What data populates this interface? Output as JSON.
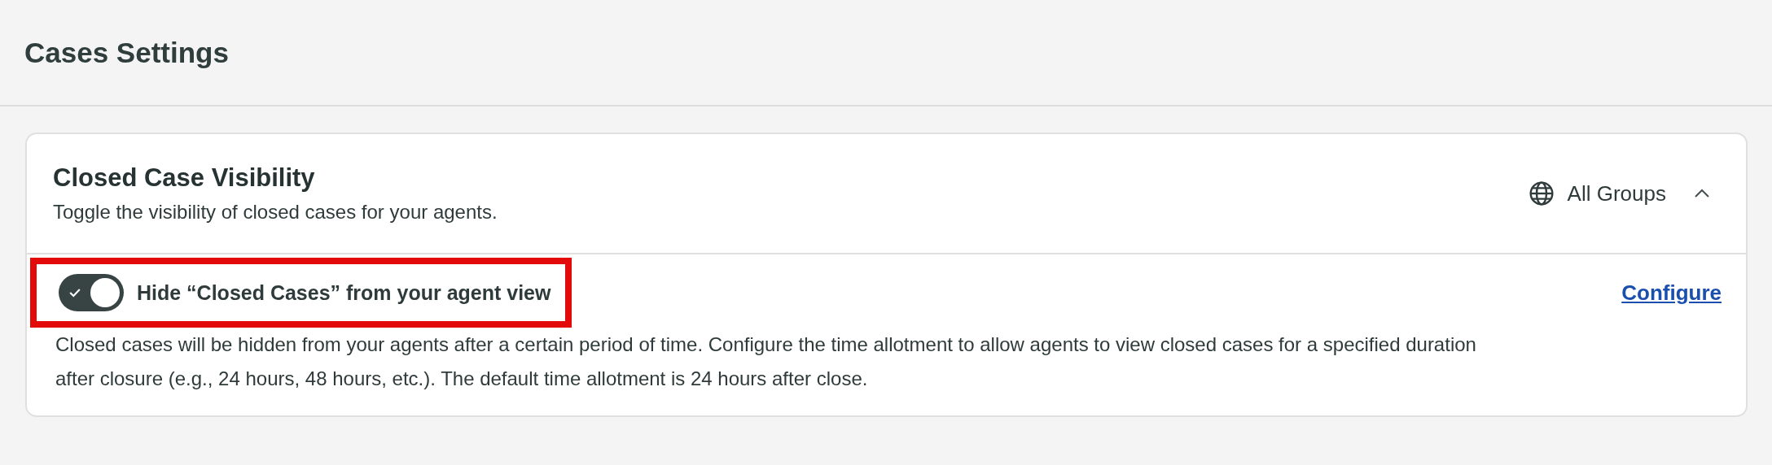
{
  "page": {
    "title": "Cases Settings"
  },
  "section": {
    "title": "Closed Case Visibility",
    "description": "Toggle the visibility of closed cases for your agents.",
    "scope": "All Groups",
    "expanded": true,
    "settings": [
      {
        "label": "Hide “Closed Cases” from your agent view",
        "on": true,
        "highlighted": true,
        "action": "Configure",
        "description": "Closed cases will be hidden from your agents after a certain period of time. Configure the time allotment to allow agents to view closed cases for a specified duration after closure (e.g., 24 hours, 48 hours, etc.). The default time allotment is 24 hours after close."
      }
    ]
  }
}
